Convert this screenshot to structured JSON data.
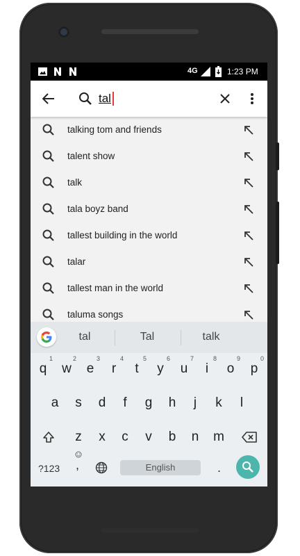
{
  "status_bar": {
    "network": "4G",
    "time": "1:23 PM"
  },
  "search": {
    "query": "tal"
  },
  "suggestions": [
    "talking tom and friends",
    "talent show",
    "talk",
    "tala boyz band",
    "tallest building in the world",
    "talar",
    "tallest man in the world",
    "taluma songs"
  ],
  "keyboard": {
    "predictions": [
      "tal",
      "Tal",
      "talk"
    ],
    "row1": [
      "q",
      "w",
      "e",
      "r",
      "t",
      "y",
      "u",
      "i",
      "o",
      "p"
    ],
    "row1_hints": [
      "1",
      "2",
      "3",
      "4",
      "5",
      "6",
      "7",
      "8",
      "9",
      "0"
    ],
    "row2": [
      "a",
      "s",
      "d",
      "f",
      "g",
      "h",
      "j",
      "k",
      "l"
    ],
    "row3": [
      "z",
      "x",
      "c",
      "v",
      "b",
      "n",
      "m"
    ],
    "symbols_key": "?123",
    "comma": ",",
    "period": ".",
    "space_label": "English"
  },
  "colors": {
    "enter": "#4db6ac",
    "caret": "#e53935"
  }
}
